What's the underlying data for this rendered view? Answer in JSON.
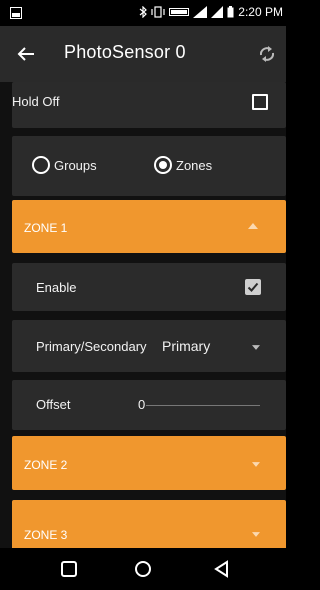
{
  "status_bar": {
    "time": "2:20 PM",
    "icons": [
      "app-notification-icon",
      "bluetooth-icon",
      "vibrate-icon",
      "volte-icon",
      "lte-signal-icon",
      "signal-icon",
      "battery-icon"
    ]
  },
  "app_bar": {
    "title": "PhotoSensor 0",
    "back_icon": "arrow-left-icon",
    "refresh_icon": "refresh-icon"
  },
  "hold_off": {
    "label": "Hold Off",
    "checked": false
  },
  "mode": {
    "options": [
      {
        "label": "Groups",
        "selected": false
      },
      {
        "label": "Zones",
        "selected": true
      }
    ]
  },
  "zones": [
    {
      "label": "ZONE 1",
      "expanded": true
    },
    {
      "label": "ZONE 2",
      "expanded": false
    },
    {
      "label": "ZONE 3",
      "expanded": false
    }
  ],
  "zone1": {
    "enable": {
      "label": "Enable",
      "checked": true
    },
    "primary_secondary": {
      "label": "Primary/Secondary",
      "value": "Primary"
    },
    "offset": {
      "label": "Offset",
      "value": "0"
    }
  },
  "colors": {
    "accent": "#f0972e",
    "card": "#2b2b2b",
    "appbar": "#2a2a2a",
    "background": "#111111"
  }
}
